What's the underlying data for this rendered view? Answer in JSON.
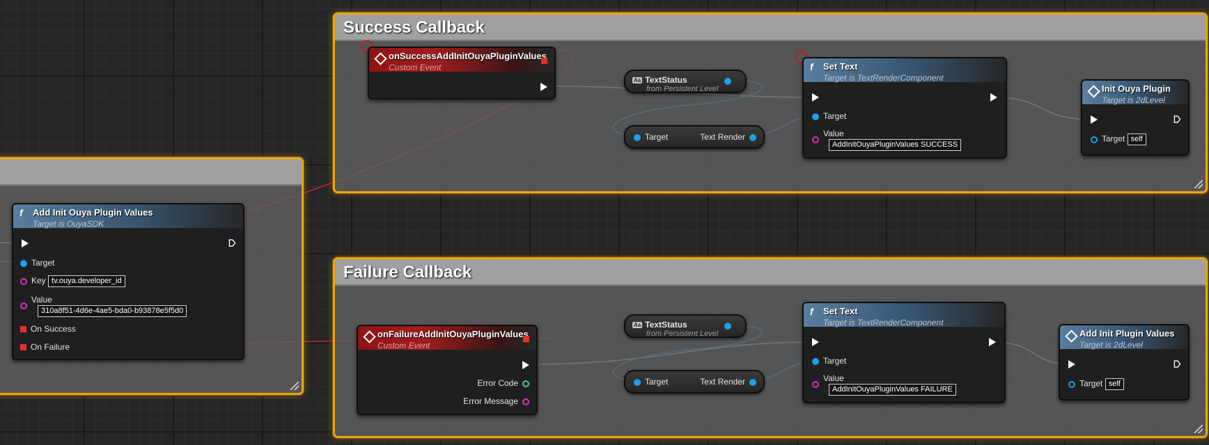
{
  "comments": {
    "success": "Success Callback",
    "failure": "Failure Callback"
  },
  "add_init_node": {
    "title": "Add Init Ouya Plugin Values",
    "subtitle": "Target is OuyaSDK",
    "target_label": "Target",
    "key_label": "Key",
    "key_value": "tv.ouya.developer_id",
    "value_label": "Value",
    "value_value": "310a8f51-4d6e-4ae5-bda0-b93878e5f5d0",
    "on_success_label": "On Success",
    "on_failure_label": "On Failure"
  },
  "success_event": {
    "title": "onSuccessAddInitOuyaPluginValues",
    "subtitle": "Custom Event"
  },
  "success_textstatus": {
    "title": "TextStatus",
    "subtitle": "from Persistent Level",
    "badge": "Aa"
  },
  "success_getter": {
    "target": "Target",
    "output": "Text Render"
  },
  "success_settext": {
    "title": "Set Text",
    "subtitle": "Target is TextRenderComponent",
    "target_label": "Target",
    "value_label": "Value",
    "value_value": "AddInitOuyaPluginValues SUCCESS"
  },
  "init_plugin": {
    "title": "Init Ouya Plugin",
    "subtitle": "Target is 2dLevel",
    "target_label": "Target",
    "target_value": "self"
  },
  "failure_event": {
    "title": "onFailureAddInitOuyaPluginValues",
    "subtitle": "Custom Event",
    "error_code": "Error Code",
    "error_message": "Error Message"
  },
  "failure_textstatus": {
    "title": "TextStatus",
    "subtitle": "from Persistent Level",
    "badge": "Aa"
  },
  "failure_getter": {
    "target": "Target",
    "output": "Text Render"
  },
  "failure_settext": {
    "title": "Set Text",
    "subtitle": "Target is TextRenderComponent",
    "target_label": "Target",
    "value_label": "Value",
    "value_value": "AddInitOuyaPluginValues FAILURE"
  },
  "add_plugin_values": {
    "title": "Add Init Plugin Values",
    "subtitle": "Target is 2dLevel",
    "target_label": "Target",
    "target_value": "self"
  },
  "icons": {
    "function": "f",
    "event": "diamond-event-icon",
    "exec": "exec-arrow-icon"
  },
  "colors": {
    "comment_border": "#e8a418",
    "exec_wire": "#d0d0d0",
    "object_wire": "#1ea0e8",
    "delegate_wire": "#e03030",
    "string_pin": "#d62fc6"
  }
}
